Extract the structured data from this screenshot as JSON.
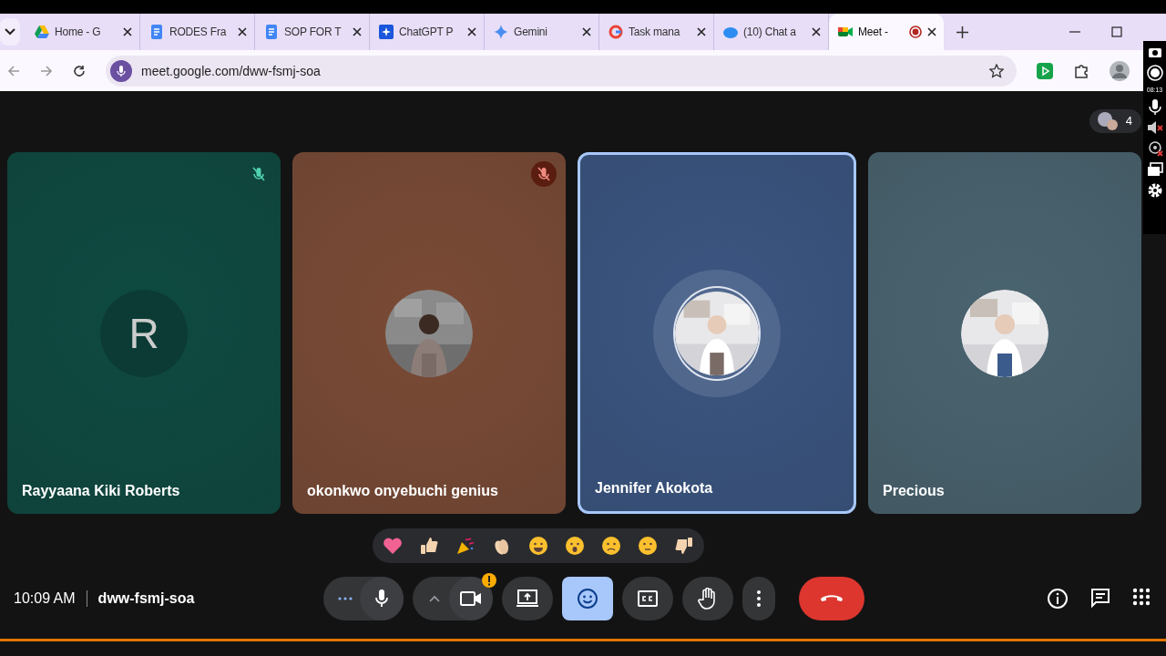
{
  "tabs": [
    {
      "title": "Home - G",
      "kind": "drive",
      "selected": false
    },
    {
      "title": "RODES Fra",
      "kind": "docs",
      "selected": false
    },
    {
      "title": "SOP FOR T",
      "kind": "docs",
      "selected": false
    },
    {
      "title": "ChatGPT P",
      "kind": "sparkle-box",
      "selected": false
    },
    {
      "title": "Gemini",
      "kind": "gemini",
      "selected": false
    },
    {
      "title": "Task mana",
      "kind": "google",
      "selected": false
    },
    {
      "title": "(10) Chat a",
      "kind": "cloud",
      "selected": false
    },
    {
      "title": "Meet -",
      "kind": "meet",
      "selected": true,
      "recording": true
    }
  ],
  "address": {
    "url": "meet.google.com/dww-fsmj-soa"
  },
  "side_toolbar": {
    "time": "08:13"
  },
  "participant_count": "4",
  "tiles": [
    {
      "name": "Rayyaana Kiki Roberts",
      "color": "#0e4a41",
      "kind": "letter",
      "initial": "R",
      "muted": true,
      "speaking": false
    },
    {
      "name": "okonkwo onyebuchi genius",
      "color": "#7a4b36",
      "kind": "picture",
      "muted": true,
      "speaking": false
    },
    {
      "name": "Jennifer Akokota",
      "color": "#3b5682",
      "kind": "picture",
      "muted": false,
      "speaking": true
    },
    {
      "name": "Precious",
      "color": "#4a6470",
      "kind": "picture",
      "muted": false,
      "speaking": false
    }
  ],
  "reactions": [
    {
      "kind": "heart"
    },
    {
      "kind": "thumbs-up"
    },
    {
      "kind": "party"
    },
    {
      "kind": "clap"
    },
    {
      "kind": "laugh"
    },
    {
      "kind": "surprised"
    },
    {
      "kind": "sad"
    },
    {
      "kind": "thinking"
    },
    {
      "kind": "thumbs-down"
    }
  ],
  "meeting": {
    "time": "10:09 AM",
    "code": "dww-fsmj-soa"
  },
  "controls": [
    {
      "kind": "mic-group"
    },
    {
      "kind": "camera-group",
      "warning": true
    },
    {
      "kind": "present",
      "active": false
    },
    {
      "kind": "reactions",
      "active": true
    },
    {
      "kind": "captions",
      "active": false
    },
    {
      "kind": "hand",
      "active": false
    },
    {
      "kind": "more",
      "active": false
    },
    {
      "kind": "leave",
      "active": false
    }
  ]
}
